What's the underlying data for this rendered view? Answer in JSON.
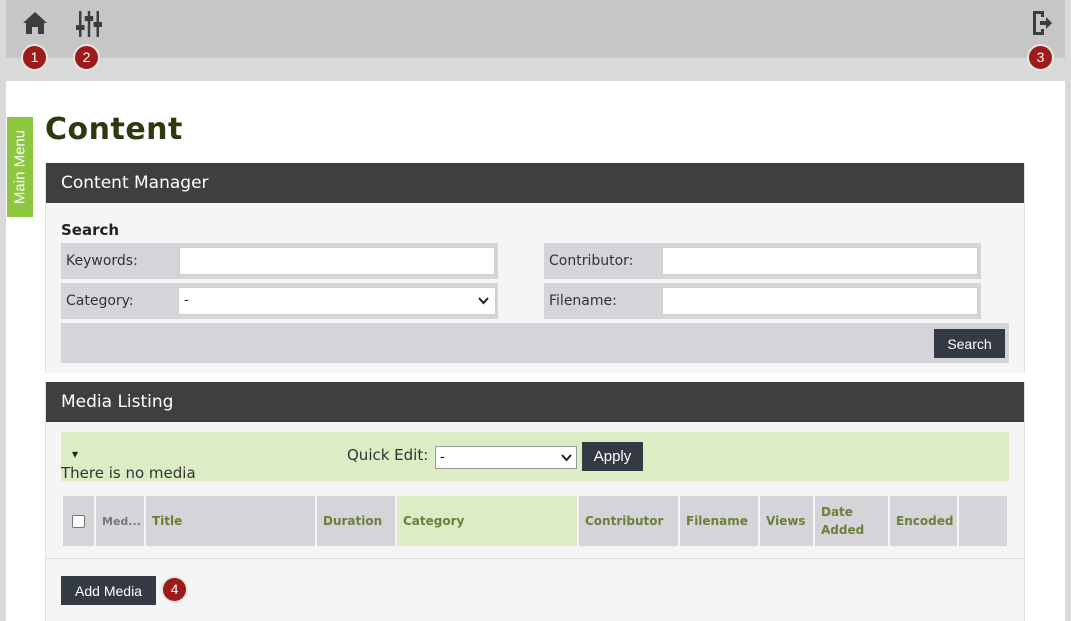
{
  "badges": [
    "1",
    "2",
    "3",
    "4"
  ],
  "side_tab": {
    "label": "Main Menu"
  },
  "page": {
    "title": "Content"
  },
  "content_manager": {
    "header": "Content Manager",
    "search_label": "Search",
    "fields": {
      "keywords": "Keywords:",
      "contributor": "Contributor:",
      "category": "Category:",
      "category_value": "-",
      "filename": "Filename:"
    },
    "search_button": "Search"
  },
  "media_listing": {
    "header": "Media Listing",
    "arrow": "▾",
    "empty_text": "There is no media",
    "quick_edit_label": "Quick Edit:",
    "quick_edit_value": "-",
    "apply_button": "Apply",
    "columns": [
      "Med...",
      "Title",
      "Duration",
      "Category",
      "Contributor",
      "Filename",
      "Views",
      "Date Added",
      "Encoded"
    ],
    "add_button": "Add Media"
  },
  "icons": [
    "home-icon",
    "settings-sliders-icon",
    "logout-icon",
    "checkbox-icon",
    "chevron-down-icon"
  ],
  "colors": {
    "accent_green": "#8dc63f",
    "header_dark": "#3f3f3f",
    "badge_red": "#9e1b1b",
    "button_dark": "#333a44"
  }
}
